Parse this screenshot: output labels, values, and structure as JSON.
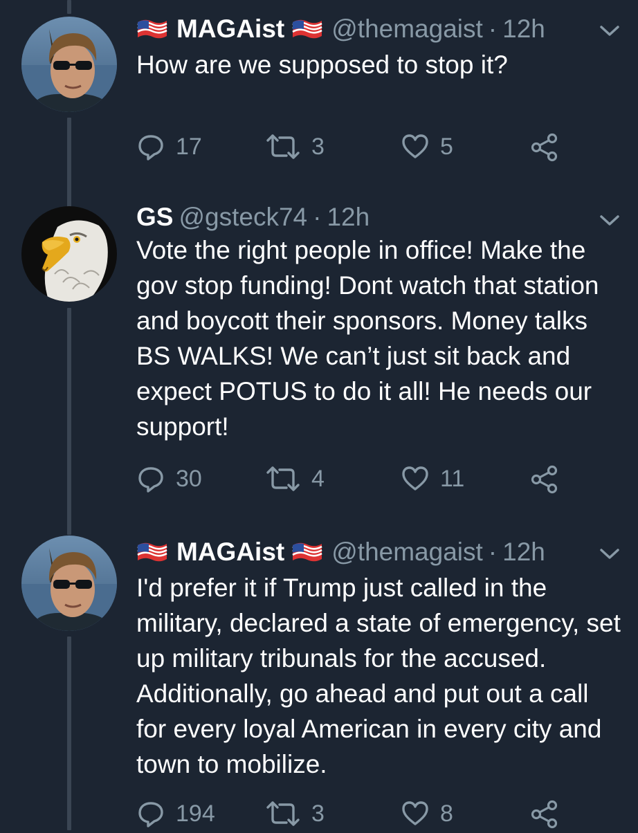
{
  "tweets": [
    {
      "display_name": "MAGAist",
      "flag_left": "🇺🇸",
      "flag_right": "🇺🇸",
      "handle": "@themagaist",
      "separator": "·",
      "time": "12h",
      "text": "How are we supposed to stop it?",
      "replies": "17",
      "retweets": "3",
      "likes": "5",
      "avatar": "man-with-sunglasses-avatar"
    },
    {
      "display_name": "GS",
      "handle": "@gsteck74",
      "separator": "·",
      "time": "12h",
      "text": "Vote the right people in office! Make the gov stop funding!  Dont watch that station and boycott their sponsors.  Money talks BS WALKS!  We can’t just sit back and expect POTUS to do it all!  He needs our support!",
      "replies": "30",
      "retweets": "4",
      "likes": "11",
      "avatar": "bald-eagle-avatar"
    },
    {
      "display_name": "MAGAist",
      "flag_left": "🇺🇸",
      "flag_right": "🇺🇸",
      "handle": "@themagaist",
      "separator": "·",
      "time": "12h",
      "text": "I'd prefer it if Trump just called in the military, declared a state of emergency, set up military tribunals for the accused. Additionally, go ahead and put out a call for every loyal American in every city and town to mobilize.",
      "replies": "194",
      "retweets": "3",
      "likes": "8",
      "avatar": "man-with-sunglasses-avatar"
    }
  ],
  "colors": {
    "background": "#1c2532",
    "text": "#ffffff",
    "muted": "#8899a6",
    "thread_line": "#3a4553"
  }
}
